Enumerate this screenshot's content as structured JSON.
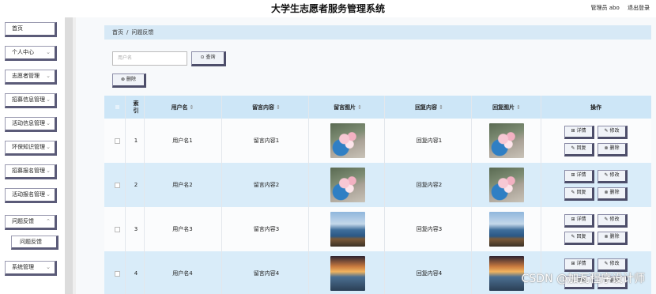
{
  "header": {
    "title": "大学生志愿者服务管理系统",
    "user_label": "管理员 abo",
    "logout_label": "退出登录"
  },
  "sidebar": {
    "items": [
      {
        "label": "首页",
        "chevron": false
      },
      {
        "label": "个人中心",
        "chevron": true
      },
      {
        "label": "志愿者管理",
        "chevron": true
      },
      {
        "label": "招募信息管理",
        "chevron": true
      },
      {
        "label": "活动信息管理",
        "chevron": true
      },
      {
        "label": "环保知识管理",
        "chevron": true
      },
      {
        "label": "招募报名管理",
        "chevron": true
      },
      {
        "label": "活动报名管理",
        "chevron": true
      },
      {
        "label": "问题反馈",
        "chevron": true
      },
      {
        "label": "系统管理",
        "chevron": true
      }
    ],
    "subitem": "问题反馈"
  },
  "breadcrumb": {
    "home": "首页",
    "sep": "/",
    "current": "问题反馈"
  },
  "search": {
    "placeholder": "用户名",
    "query_label": "⊙ 查询"
  },
  "toolbar": {
    "delete_label": "⊗ 删除"
  },
  "table": {
    "headers": {
      "index": "索引",
      "username": "用户名",
      "message": "留言内容",
      "message_image": "留言图片",
      "reply": "回复内容",
      "reply_image": "回复图片",
      "actions": "操作"
    },
    "sort_glyph": "⇕",
    "rows": [
      {
        "index": "1",
        "username": "用户名1",
        "message": "留言内容1",
        "reply": "回复内容1",
        "image": "flowers"
      },
      {
        "index": "2",
        "username": "用户名2",
        "message": "留言内容2",
        "reply": "回复内容2",
        "image": "flowers"
      },
      {
        "index": "3",
        "username": "用户名3",
        "message": "留言内容3",
        "reply": "回复内容3",
        "image": "coast"
      },
      {
        "index": "4",
        "username": "用户名4",
        "message": "留言内容4",
        "reply": "回复内容4",
        "image": "sunset"
      }
    ],
    "actions": {
      "detail": "⊞ 详情",
      "edit": "✎ 修改",
      "reply": "✎ 回复",
      "delete": "⊗ 删除"
    }
  },
  "watermark": "CSDN @加瓦程序设计师"
}
